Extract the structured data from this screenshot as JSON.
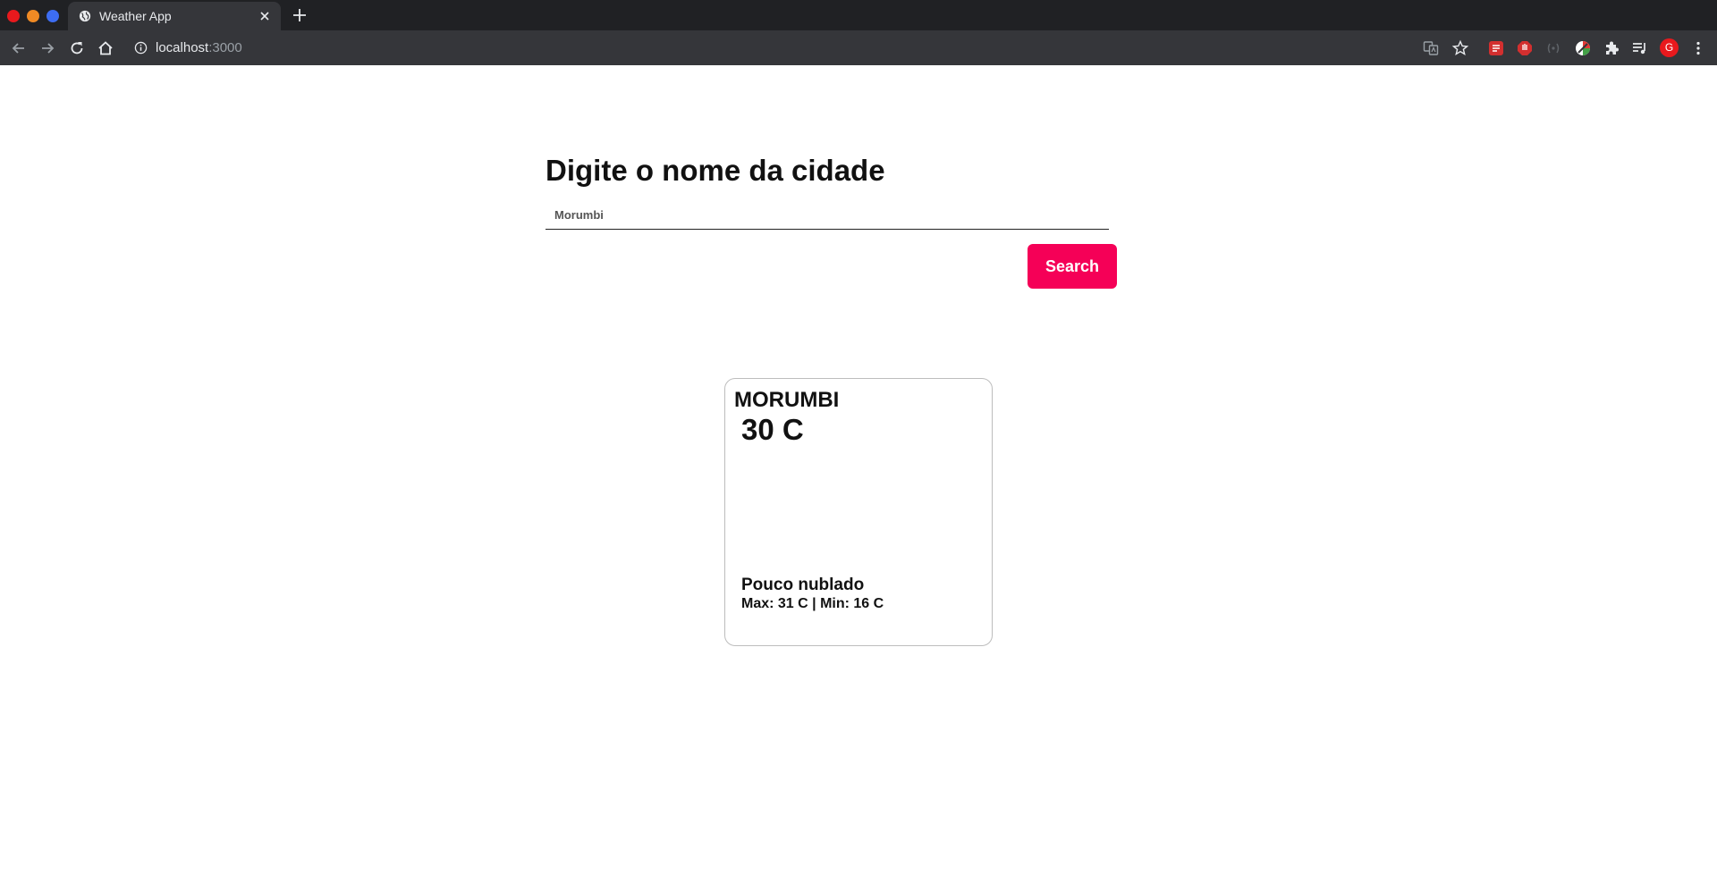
{
  "browser": {
    "tab": {
      "title": "Weather App"
    },
    "address_bar": {
      "host": "localhost",
      "port": ":3000"
    },
    "profile_initial": "G",
    "icons": {
      "tab_favicon": "globe-icon",
      "nav": [
        "back-arrow-icon",
        "forward-arrow-icon",
        "reload-icon",
        "home-icon"
      ],
      "toolbar_right": [
        "translate-icon",
        "star-icon",
        "extension-red-icon",
        "extension-stop-icon",
        "extension-dark-icon",
        "extension-color-icon",
        "puzzle-icon",
        "media-queue-icon",
        "more-vert-icon"
      ]
    }
  },
  "page": {
    "heading": "Digite o nome da cidade",
    "search": {
      "value": "Morumbi",
      "placeholder": ""
    },
    "search_button": "Search",
    "card": {
      "city": "MORUMBI",
      "temperature": "30 C",
      "description": "Pouco nublado",
      "minmax": "Max: 31 C | Min: 16 C"
    }
  },
  "colors": {
    "accent": "#f50057",
    "chrome_dark": "#202124",
    "chrome_toolbar": "#35363a",
    "text": "#111111"
  }
}
